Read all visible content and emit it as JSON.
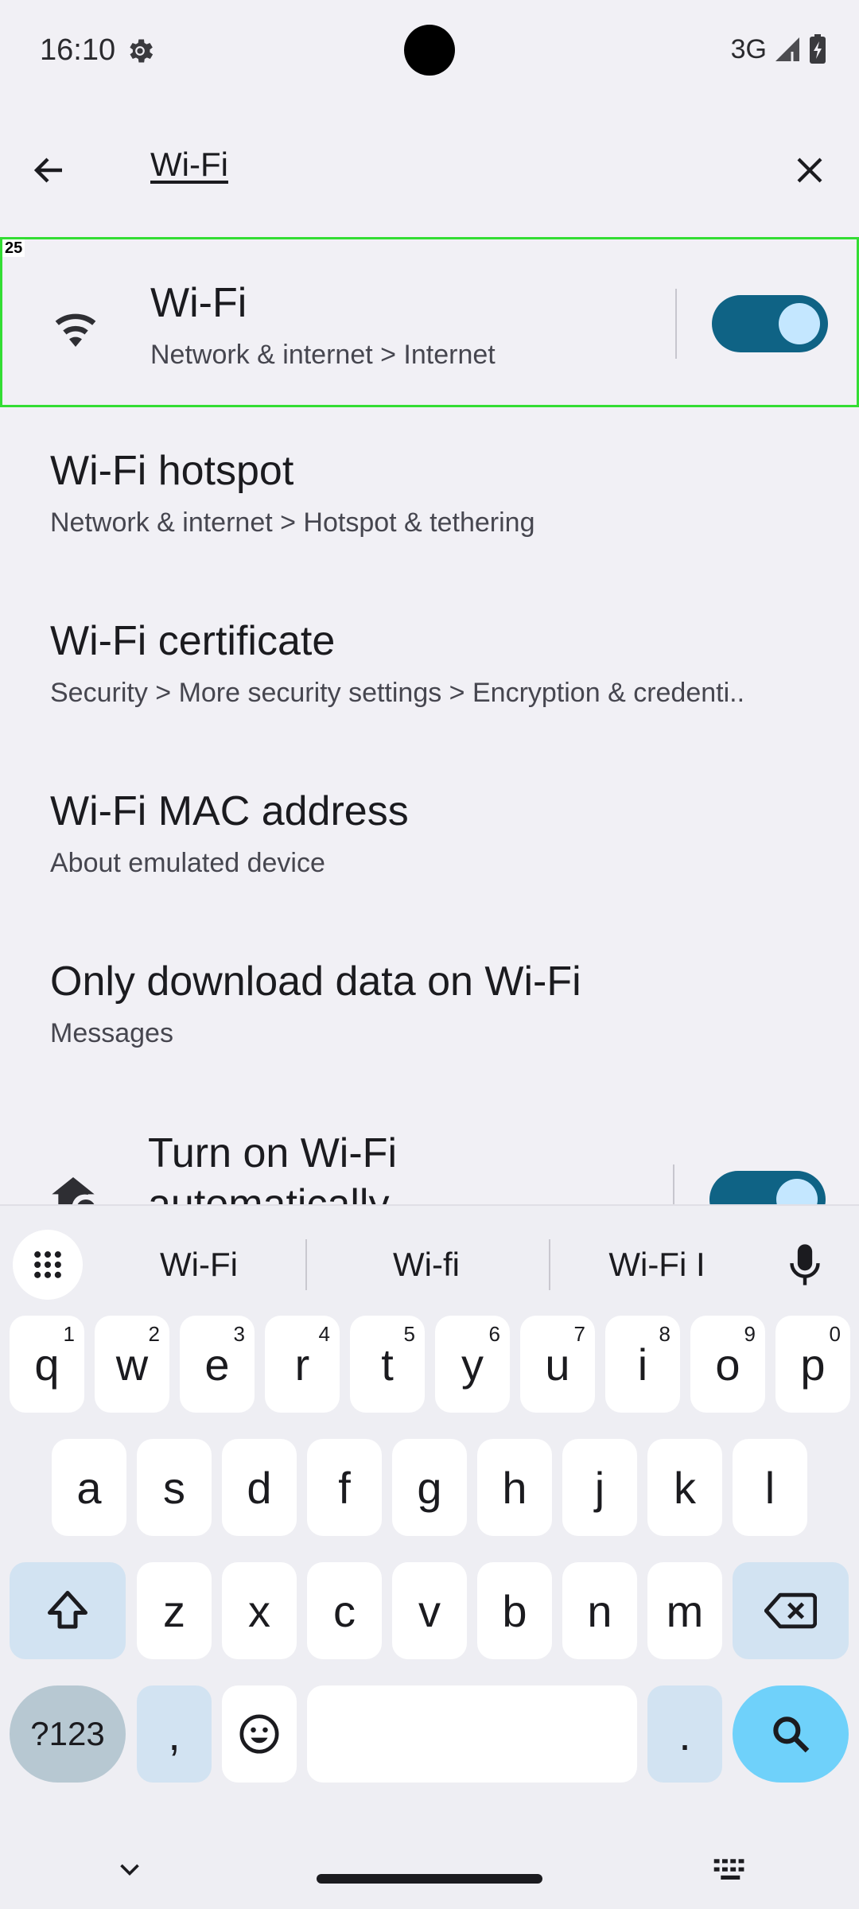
{
  "status_bar": {
    "time": "16:10",
    "network": "3G"
  },
  "search": {
    "query": "Wi-Fi"
  },
  "results": [
    {
      "title": "Wi-Fi",
      "subtitle": "Network & internet > Internet",
      "badge": "25",
      "toggle_on": true
    },
    {
      "title": "Wi-Fi hotspot",
      "subtitle": "Network & internet > Hotspot & tethering"
    },
    {
      "title": "Wi-Fi certificate",
      "subtitle": "Security > More security settings > Encryption & credenti.."
    },
    {
      "title": "Wi-Fi MAC address",
      "subtitle": "About emulated device"
    },
    {
      "title": "Only download data on Wi-Fi",
      "subtitle": "Messages"
    },
    {
      "title": "Turn on Wi-Fi automatically",
      "toggle_on": true
    }
  ],
  "keyboard": {
    "suggestions": [
      "Wi-Fi",
      "Wi-fi",
      "Wi-Fi I"
    ],
    "row1": [
      {
        "key": "q",
        "hint": "1"
      },
      {
        "key": "w",
        "hint": "2"
      },
      {
        "key": "e",
        "hint": "3"
      },
      {
        "key": "r",
        "hint": "4"
      },
      {
        "key": "t",
        "hint": "5"
      },
      {
        "key": "y",
        "hint": "6"
      },
      {
        "key": "u",
        "hint": "7"
      },
      {
        "key": "i",
        "hint": "8"
      },
      {
        "key": "o",
        "hint": "9"
      },
      {
        "key": "p",
        "hint": "0"
      }
    ],
    "row2": [
      "a",
      "s",
      "d",
      "f",
      "g",
      "h",
      "j",
      "k",
      "l"
    ],
    "row3": [
      "z",
      "x",
      "c",
      "v",
      "b",
      "n",
      "m"
    ],
    "num_label": "?123",
    "comma": ",",
    "period": "."
  },
  "colors": {
    "accent_toggle": "#0f6385",
    "toggle_knob": "#c4e7ff",
    "highlight_border": "#33dd33",
    "search_key": "#6fd1fa",
    "function_key": "#d2e3f2"
  }
}
